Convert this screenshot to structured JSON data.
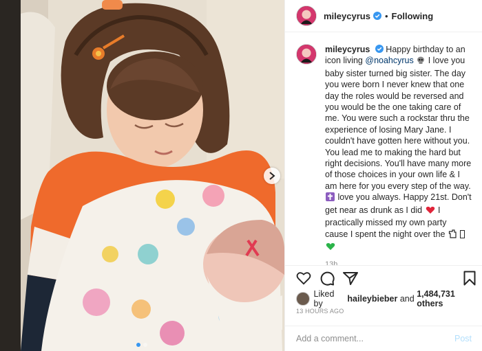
{
  "post": {
    "username": "mileycyrus",
    "separator": "•",
    "follow_label": "Following",
    "carousel_dots": 2,
    "active_dot": 0
  },
  "caption": {
    "username": "mileycyrus",
    "part1": "Happy birthday to an icon living",
    "mention": "@noahcyrus",
    "part2": "I love you baby sister turned big sister. The day you were born I never knew that one day the roles would be reversed and you would be the one taking care of me. You were such a rockstar thru the experience of losing Mary Jane. I couldn't have gotten here without you. You lead me to making the hard but right decisions. You'll have many more of those choices in your own life & I am here for you every step of the way.",
    "part3": "love you always. Happy 21st. Don't get near as drunk as I did",
    "part4": "I practically missed my own party cause I spent the night over the",
    "time": "13h"
  },
  "likes": {
    "prefix": "Liked by",
    "user": "haileybieber",
    "connector": "and",
    "count": "1,484,731 others"
  },
  "date": "13 HOURS AGO",
  "comment_box": {
    "placeholder": "Add a comment...",
    "post_label": "Post"
  },
  "colors": {
    "verified": "#3897f0",
    "post_button": "#b2dffc",
    "mention": "#00376b"
  },
  "icons": [
    "verified-icon",
    "skull-icon",
    "cross-icon",
    "heart-emoji-icon",
    "green-heart-icon",
    "heart-icon",
    "comment-icon",
    "share-icon",
    "bookmark-icon",
    "next-arrow-icon"
  ]
}
